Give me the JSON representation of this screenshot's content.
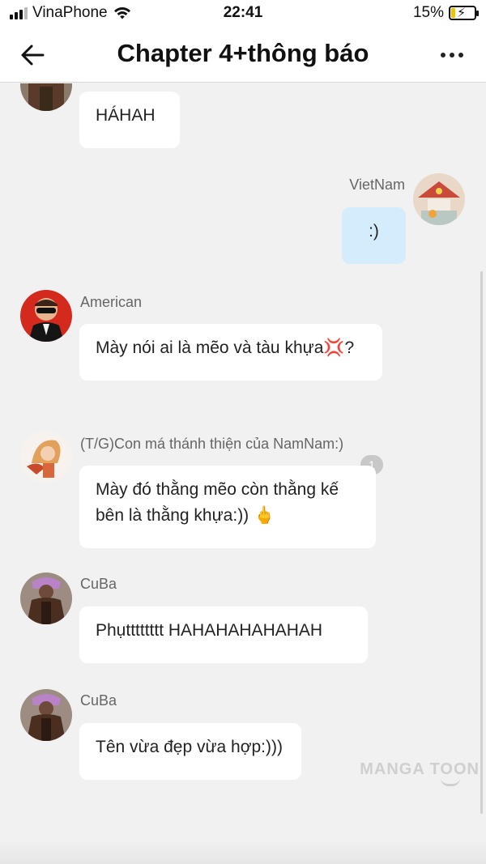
{
  "status_bar": {
    "carrier": "VinaPhone",
    "time": "22:41",
    "battery_percent": "15%",
    "battery_level": 0.15,
    "icons": [
      "signal-icon",
      "wifi-icon",
      "battery-charging-icon"
    ]
  },
  "header": {
    "title": "Chapter 4+thông báo",
    "icons": [
      "back-arrow-icon",
      "more-icon"
    ]
  },
  "messages": [
    {
      "sender": "",
      "text": "HÁHAH",
      "side": "left",
      "avatar": "cuba-avatar-partial"
    },
    {
      "sender": "VietNam",
      "text": ":)",
      "side": "right",
      "avatar": "vietnam-avatar"
    },
    {
      "sender": "American",
      "text": "Mày nói ai là mẽo và tàu khựa💢?",
      "side": "left",
      "avatar": "american-avatar"
    },
    {
      "sender": "(T/G)Con má thánh thiện của NamNam:)",
      "text": "Mày đó thằng mẽo còn thằng kế bên là thằng khựa:)) 🖕",
      "side": "left",
      "avatar": "author-avatar",
      "badge": "1"
    },
    {
      "sender": "CuBa",
      "text": "Phụtttttttt HAHAHAHAHAHAH",
      "side": "left",
      "avatar": "cuba-avatar"
    },
    {
      "sender": "CuBa",
      "text": "Tên vừa đẹp vừa hợp:)))",
      "side": "left",
      "avatar": "cuba-avatar"
    }
  ],
  "watermark": "MANGA TOON",
  "colors": {
    "background": "#f1f1f1",
    "bubble": "#ffffff",
    "my_bubble": "#d4ecfb",
    "sender_text": "#666666"
  }
}
